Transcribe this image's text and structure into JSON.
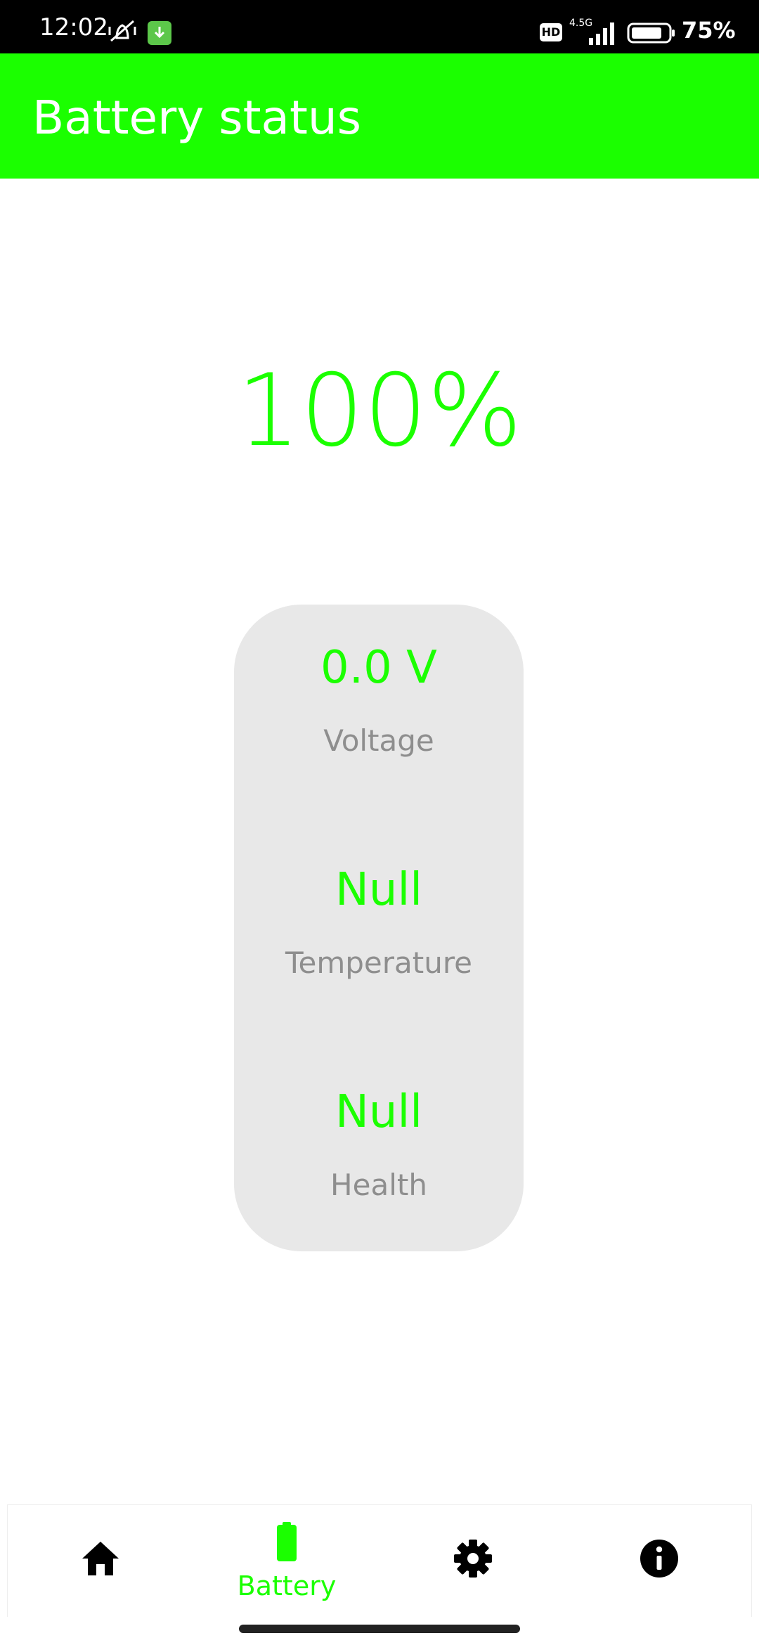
{
  "status_bar": {
    "time": "12:02",
    "network": "4.5G",
    "hd": "HD",
    "battery_percent": "75%"
  },
  "app_bar": {
    "title": "Battery status",
    "color": "#1bff00"
  },
  "main": {
    "percentage": "100%",
    "stats": [
      {
        "value": "0.0 V",
        "label": "Voltage"
      },
      {
        "value": "Null",
        "label": "Temperature"
      },
      {
        "value": "Null",
        "label": "Health"
      }
    ]
  },
  "bottom_nav": {
    "items": [
      {
        "icon": "home-icon",
        "label": "",
        "active": false
      },
      {
        "icon": "battery-icon",
        "label": "Battery",
        "active": true
      },
      {
        "icon": "gear-icon",
        "label": "",
        "active": false
      },
      {
        "icon": "info-icon",
        "label": "",
        "active": false
      }
    ],
    "active_color": "#1bff00"
  }
}
